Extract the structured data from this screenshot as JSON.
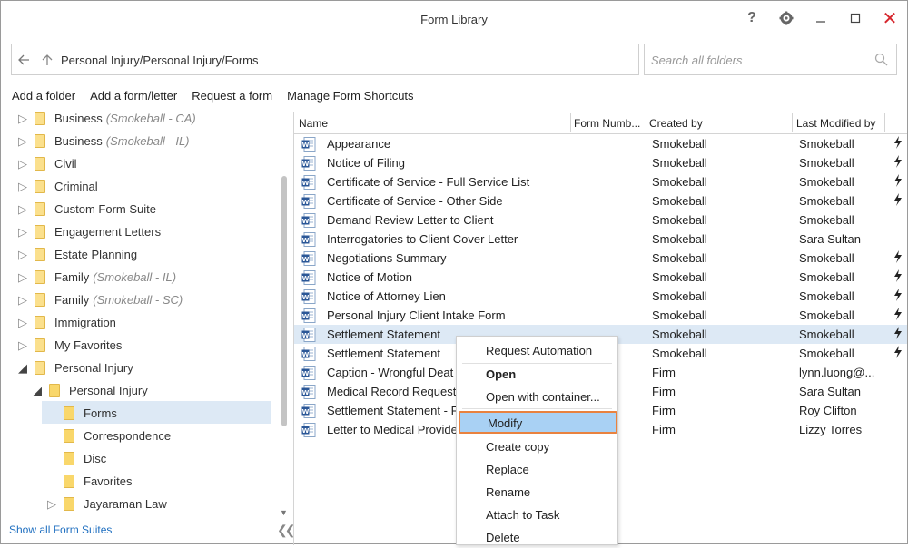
{
  "window": {
    "title": "Form Library"
  },
  "titlebar": {
    "help": "?",
    "close": "✕"
  },
  "address": {
    "path": "Personal Injury/Personal Injury/Forms"
  },
  "search": {
    "placeholder": "Search all folders"
  },
  "toolbar": {
    "add_folder": "Add a folder",
    "add_form": "Add a form/letter",
    "request_form": "Request a form",
    "manage_shortcuts": "Manage Form Shortcuts"
  },
  "tree": {
    "items": [
      {
        "label": "Business",
        "suffix": "(Smokeball - CA)"
      },
      {
        "label": "Business",
        "suffix": "(Smokeball - IL)"
      },
      {
        "label": "Civil",
        "suffix": ""
      },
      {
        "label": "Criminal",
        "suffix": ""
      },
      {
        "label": "Custom Form Suite",
        "suffix": ""
      },
      {
        "label": "Engagement Letters",
        "suffix": ""
      },
      {
        "label": "Estate Planning",
        "suffix": ""
      },
      {
        "label": "Family",
        "suffix": "(Smokeball - IL)"
      },
      {
        "label": "Family",
        "suffix": "(Smokeball - SC)"
      },
      {
        "label": "Immigration",
        "suffix": ""
      },
      {
        "label": "My Favorites",
        "suffix": ""
      },
      {
        "label": "Personal Injury",
        "suffix": ""
      },
      {
        "label": "Personal Injury",
        "suffix": ""
      },
      {
        "label": "Forms",
        "suffix": ""
      },
      {
        "label": "Correspondence",
        "suffix": ""
      },
      {
        "label": "Disc",
        "suffix": ""
      },
      {
        "label": "Favorites",
        "suffix": ""
      },
      {
        "label": "Jayaraman Law",
        "suffix": ""
      }
    ],
    "show_all": "Show all Form Suites"
  },
  "table": {
    "columns": {
      "name": "Name",
      "form_number": "Form Numb...",
      "created_by": "Created by",
      "last_modified": "Last Modified by"
    },
    "rows": [
      {
        "name": "Appearance",
        "created": "Smokeball",
        "modified": "Smokeball",
        "flag": true
      },
      {
        "name": "Notice of Filing",
        "created": "Smokeball",
        "modified": "Smokeball",
        "flag": true
      },
      {
        "name": "Certificate of Service - Full Service List",
        "created": "Smokeball",
        "modified": "Smokeball",
        "flag": true
      },
      {
        "name": "Certificate of Service - Other Side",
        "created": "Smokeball",
        "modified": "Smokeball",
        "flag": true
      },
      {
        "name": "Demand Review Letter to Client",
        "created": "Smokeball",
        "modified": "Smokeball",
        "flag": false
      },
      {
        "name": "Interrogatories to Client Cover Letter",
        "created": "Smokeball",
        "modified": "Sara Sultan",
        "flag": false
      },
      {
        "name": "Negotiations Summary",
        "created": "Smokeball",
        "modified": "Smokeball",
        "flag": true
      },
      {
        "name": "Notice of Motion",
        "created": "Smokeball",
        "modified": "Smokeball",
        "flag": true
      },
      {
        "name": "Notice of Attorney Lien",
        "created": "Smokeball",
        "modified": "Smokeball",
        "flag": true
      },
      {
        "name": "Personal Injury Client Intake Form",
        "created": "Smokeball",
        "modified": "Smokeball",
        "flag": true
      },
      {
        "name": "Settlement Statement",
        "created": "Smokeball",
        "modified": "Smokeball",
        "flag": true
      },
      {
        "name": "Settlement Statement",
        "created": "Smokeball",
        "modified": "Smokeball",
        "flag": true
      },
      {
        "name": "Caption - Wrongful Deat",
        "created": "Firm",
        "modified": "lynn.luong@...",
        "flag": false
      },
      {
        "name": "Medical Record Request",
        "created": "Firm",
        "modified": "Sara Sultan",
        "flag": false
      },
      {
        "name": "Settlement Statement - F",
        "created": "Firm",
        "modified": "Roy Clifton",
        "flag": false
      },
      {
        "name": "Letter to Medical Provide",
        "created": "Firm",
        "modified": "Lizzy Torres",
        "flag": false
      }
    ]
  },
  "context_menu": {
    "items": [
      "Request Automation",
      "Open",
      "Open with container...",
      "Modify",
      "Create copy",
      "Replace",
      "Rename",
      "Attach to Task",
      "Delete"
    ]
  },
  "colors": {
    "selection": "#dde9f5",
    "menu_highlight": "#a9d1f4",
    "highlight_border": "#e9823f",
    "folder": "#f9d76b",
    "link": "#1f6fc0",
    "close": "#d6262d"
  }
}
